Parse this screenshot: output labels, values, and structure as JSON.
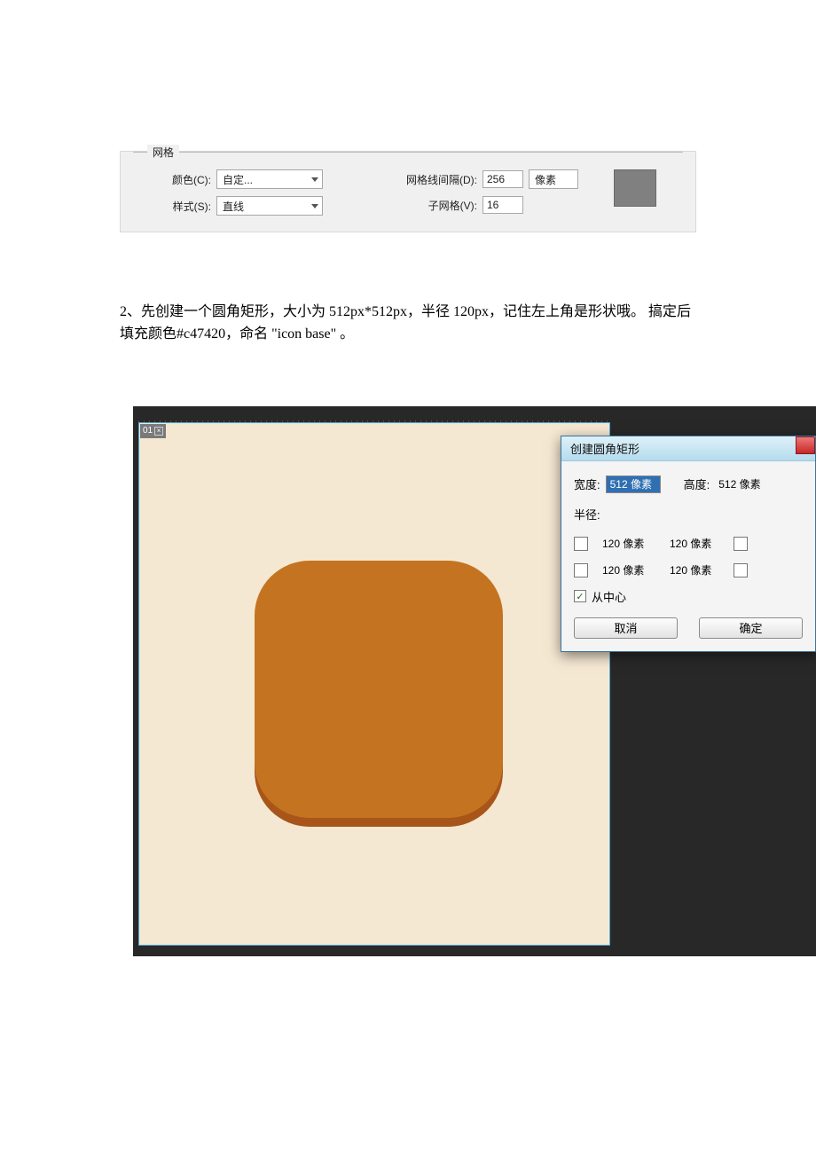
{
  "grid_panel": {
    "legend": "网格",
    "color_label": "颜色(C):",
    "color_value": "自定...",
    "style_label": "样式(S):",
    "style_value": "直线",
    "spacing_label": "网格线间隔(D):",
    "spacing_value": "256",
    "unit": "像素",
    "subgrid_label": "子网格(V):",
    "subgrid_value": "16"
  },
  "paragraph": "2、先创建一个圆角矩形，大小为 512px*512px，半径 120px，记住左上角是形状哦。 搞定后填充颜色#c47420，命名 \"icon base\" 。",
  "editor": {
    "tab_label": "01"
  },
  "dialog": {
    "title": "创建圆角矩形",
    "width_label": "宽度:",
    "width_value": "512 像素",
    "height_label": "高度:",
    "height_value": "512 像素",
    "radius_label": "半径:",
    "corner_value": "120 像素",
    "from_center_label": "从中心",
    "cancel": "取消",
    "ok": "确定"
  }
}
